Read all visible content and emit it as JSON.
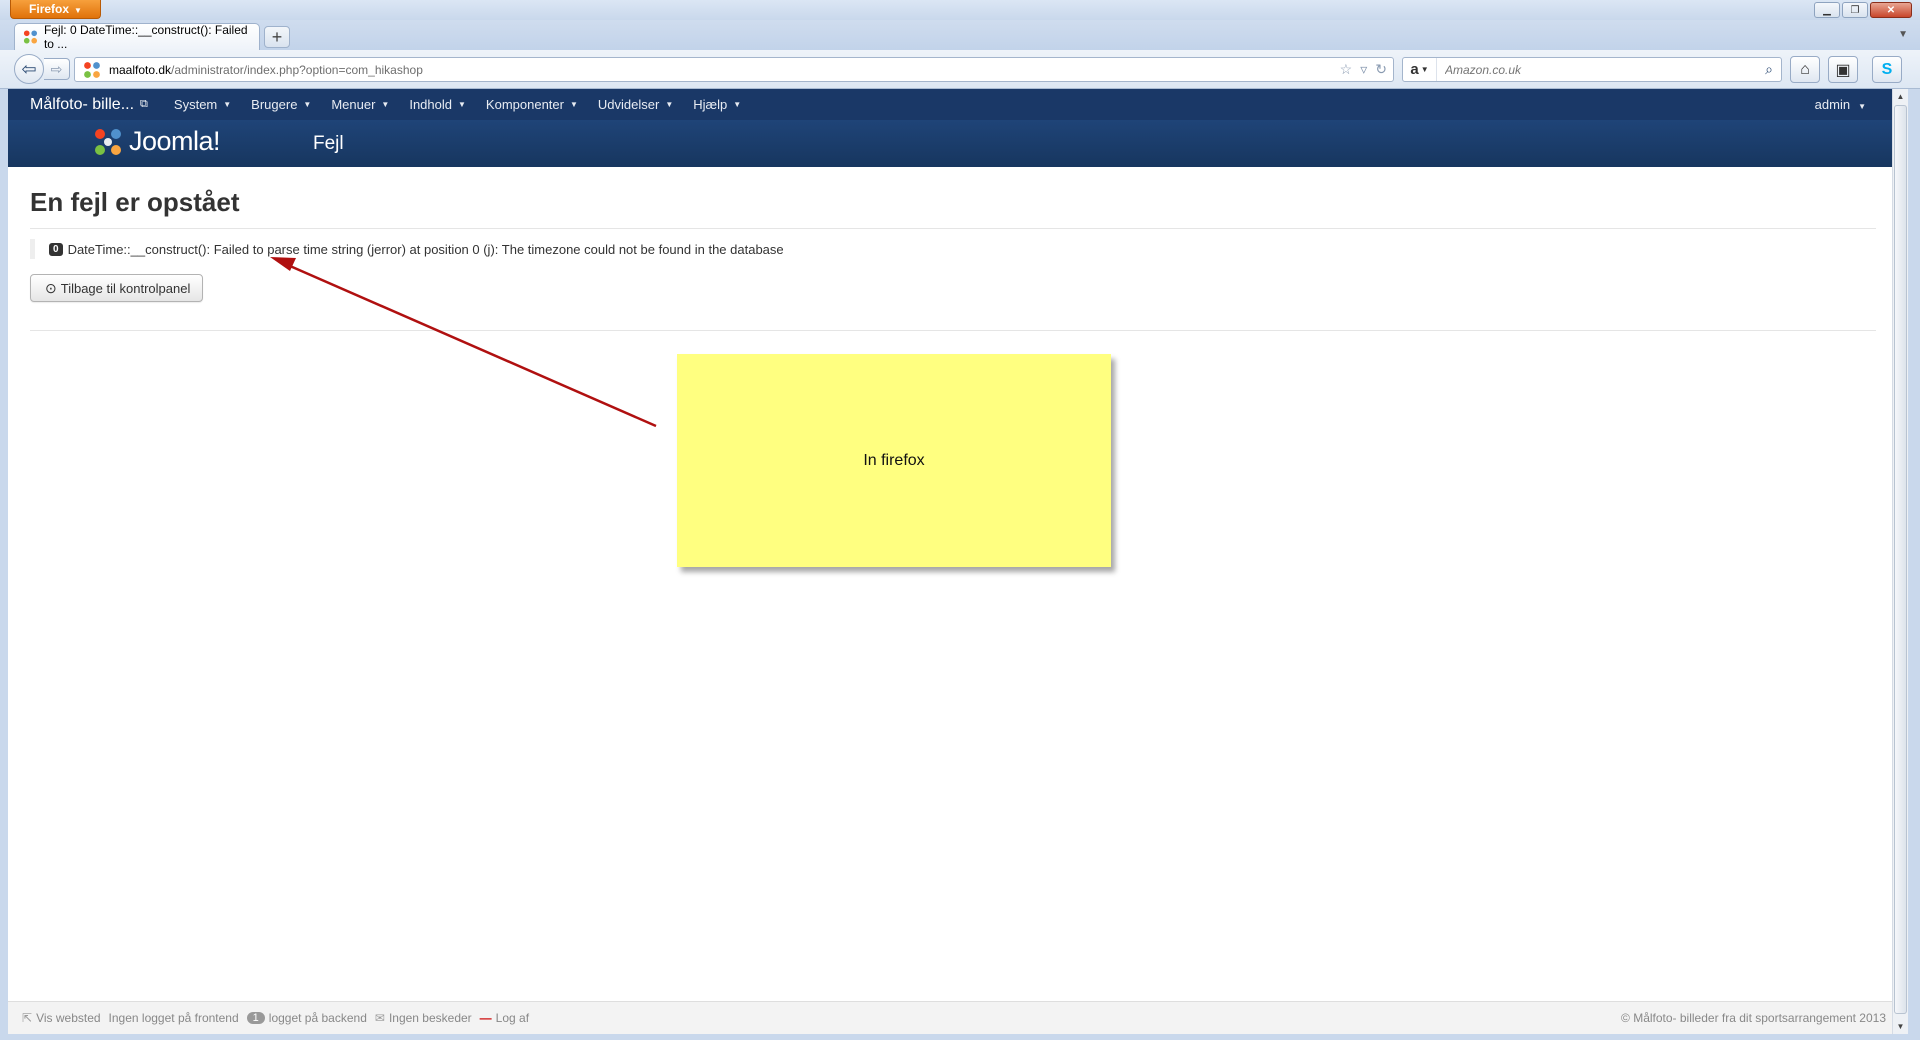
{
  "browser": {
    "menu_button": "Firefox",
    "tab_title": "Fejl: 0 DateTime::__construct(): Failed to ...",
    "url_domain": "maalfoto.dk",
    "url_path": "/administrator/index.php?option=com_hikashop",
    "search_placeholder": "Amazon.co.uk",
    "new_tab_label": "+"
  },
  "joomla": {
    "site_name": "Målfoto- bille...",
    "menu": [
      "System",
      "Brugere",
      "Menuer",
      "Indhold",
      "Komponenter",
      "Udvidelser",
      "Hjælp"
    ],
    "user_menu": "admin",
    "logo_text": "Joomla!",
    "page_title": "Fejl"
  },
  "content": {
    "heading": "En fejl er opstået",
    "error_code": "0",
    "error_message": "DateTime::__construct(): Failed to parse time string (jerror) at position 0 (j): The timezone could not be found in the database",
    "back_button": "Tilbage til kontrolpanel"
  },
  "annotation": {
    "note_text": "In firefox",
    "note_color": "#ffff80",
    "arrow_color": "#b01010"
  },
  "status_bar": {
    "view_site": "Vis websted",
    "frontend": "Ingen logget på frontend",
    "backend_count": "1",
    "backend": "logget på backend",
    "messages": "Ingen beskeder",
    "logout": "Log af",
    "copyright": "© Målfoto- billeder fra dit sportsarrangement 2013"
  },
  "colors": {
    "joomla_menu_bg": "#1a3867",
    "joomla_header_bg": "#1f4478",
    "firefox_orange": "#e0720b"
  }
}
